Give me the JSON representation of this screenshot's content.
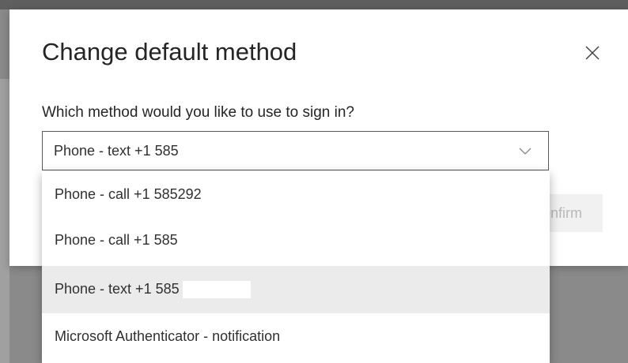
{
  "dialog": {
    "title": "Change default method",
    "question": "Which method would you like to use to sign in?",
    "select": {
      "value": "Phone - text +1 585"
    },
    "confirm_label": "Confirm"
  },
  "dropdown": {
    "options": [
      {
        "label": "Phone - call +1 585292",
        "selected": false
      },
      {
        "label": "Phone - call +1 585",
        "selected": false
      },
      {
        "label": "Phone - text +1 585",
        "selected": true
      },
      {
        "label": "Microsoft Authenticator - notification",
        "selected": false
      }
    ]
  },
  "icons": {
    "close": "close-icon",
    "chevron": "chevron-down-icon"
  },
  "colors": {
    "backdrop": "#8a8a8a",
    "dialog_bg": "#ffffff",
    "text": "#252525",
    "selected_option_bg": "#ebebeb",
    "disabled_button_bg": "#f1f1f1",
    "disabled_button_text": "#b9b9b9"
  }
}
